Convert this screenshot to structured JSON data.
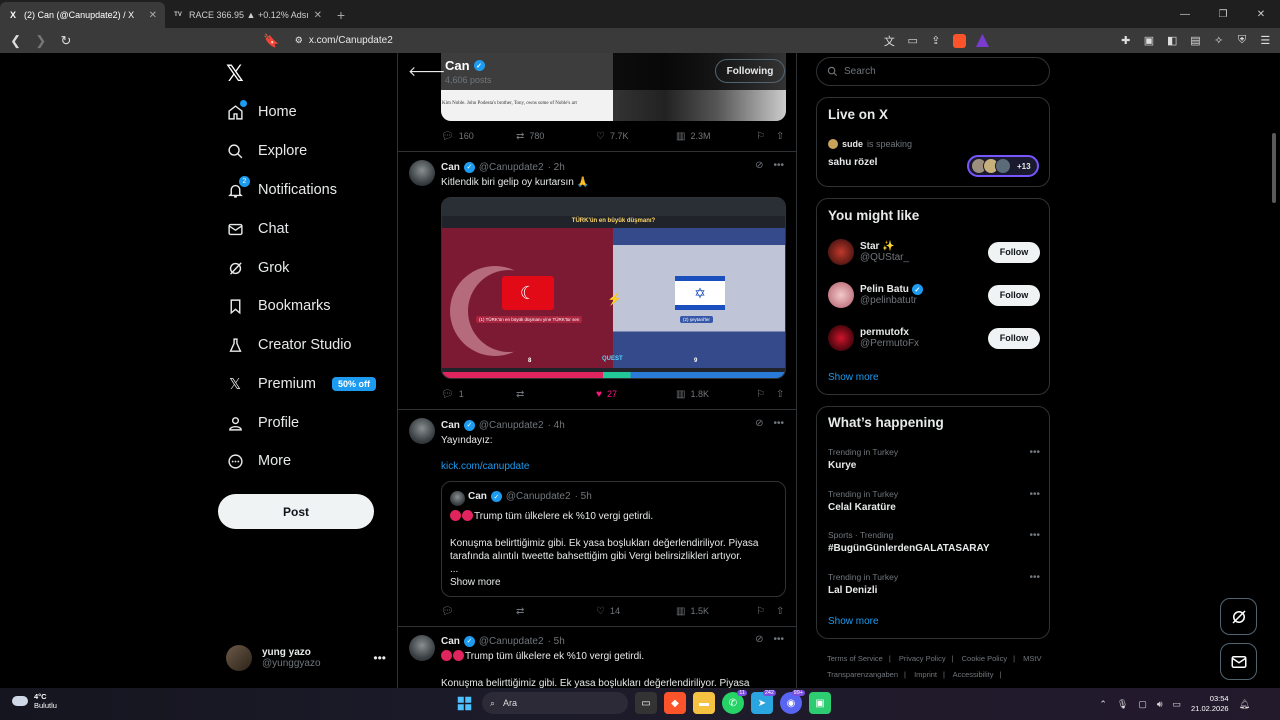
{
  "browser": {
    "tabs": [
      {
        "title": "(2) Can (@Canupdate2) / X",
        "favicon": "X",
        "active": true
      },
      {
        "title": "RACE 366.95 ▲ +0.12% Adsız",
        "favicon": "TV",
        "active": false
      }
    ],
    "url": "x.com/Canupdate2"
  },
  "leftnav": {
    "items": [
      {
        "label": "Home",
        "icon": "home-icon"
      },
      {
        "label": "Explore",
        "icon": "search-icon"
      },
      {
        "label": "Notifications",
        "icon": "bell-icon",
        "badge": "2"
      },
      {
        "label": "Chat",
        "icon": "mail-icon"
      },
      {
        "label": "Grok",
        "icon": "grok-icon"
      },
      {
        "label": "Bookmarks",
        "icon": "bookmark-icon"
      },
      {
        "label": "Creator Studio",
        "icon": "flask-icon"
      },
      {
        "label": "Premium",
        "icon": "x-icon",
        "badge": "50% off"
      },
      {
        "label": "Profile",
        "icon": "person-icon"
      },
      {
        "label": "More",
        "icon": "more-circle-icon"
      }
    ],
    "post_label": "Post",
    "account": {
      "name": "yung yazo",
      "handle": "@yunggyazo"
    }
  },
  "profile_header": {
    "name": "Can",
    "posts": "4,606 posts",
    "following_label": "Following"
  },
  "feed": {
    "prev_media_caption": "Kim Noble. John Podesta's brother, Tony, owns some of Noble's art",
    "prev_actions": {
      "replies": "160",
      "reposts": "780",
      "likes": "7.7K",
      "views": "2.3M"
    },
    "tweets": [
      {
        "name": "Can",
        "handle": "@Canupdate2",
        "time": "· 2h",
        "text": "Kitlendik biri gelip oy kurtarsın 🙏",
        "media": {
          "title": "TÜRK'ün en büyük düşmanı?",
          "left_caption": "(1) TÜRK'ün en büyük düşmanı yine TÜRK'tür sen",
          "right_caption": "(2) şeytanl'ler",
          "left_score": "8",
          "right_score": "9",
          "logo": "QUEST"
        },
        "actions": {
          "replies": "1",
          "reposts": "",
          "likes": "27",
          "views": "1.8K"
        }
      },
      {
        "name": "Can",
        "handle": "@Canupdate2",
        "time": "· 4h",
        "text": "Yayındayız:",
        "link": "kick.com/canupdate",
        "quote": {
          "name": "Can",
          "handle": "@Canupdate2",
          "time": "· 5h",
          "line1": "Trump tüm ülkelere ek %10 vergi getirdi.",
          "line2": "Konuşma belirttiğimiz gibi. Ek yasa boşlukları değerlendiriliyor. Piyasa tarafında alıntılı tweette bahsettiğim gibi Vergi belirsizlikleri artıyor.",
          "ellipsis": "...",
          "show_more": "Show more"
        },
        "actions": {
          "replies": "",
          "reposts": "",
          "likes": "14",
          "views": "1.5K"
        }
      },
      {
        "name": "Can",
        "handle": "@Canupdate2",
        "time": "· 5h",
        "line1": "Trump tüm ülkelere ek %10 vergi getirdi.",
        "line2": "Konuşma belirttiğimiz gibi. Ek yasa boşlukları değerlendiriliyor. Piyasa"
      }
    ]
  },
  "right": {
    "search_placeholder": "Search",
    "live": {
      "title": "Live on X",
      "speaker": "sude",
      "speaking": "is speaking",
      "room": "sahu rözel",
      "extra": "+13"
    },
    "might_like": {
      "title": "You might like",
      "users": [
        {
          "name": "Star ✨",
          "handle": "@QUStar_",
          "verified": false
        },
        {
          "name": "Pelin Batu",
          "handle": "@pelinbatutr",
          "verified": true
        },
        {
          "name": "permutofx",
          "handle": "@PermutoFx",
          "verified": false
        }
      ],
      "follow_label": "Follow",
      "show_more": "Show more"
    },
    "happening": {
      "title": "What’s happening",
      "trends": [
        {
          "context": "Trending in Turkey",
          "name": "Kurye"
        },
        {
          "context": "Trending in Turkey",
          "name": "Celal Karatüre"
        },
        {
          "context": "Sports · Trending",
          "name": "#BugünGünlerdenGALATASARAY"
        },
        {
          "context": "Trending in Turkey",
          "name": "Lal Denizli"
        }
      ],
      "show_more": "Show more"
    },
    "footer": [
      "Terms of Service",
      "|",
      "Privacy Policy",
      "|",
      "Cookie Policy",
      "|",
      "MStV Transparenzangaben",
      "|",
      "Imprint",
      "|",
      "Accessibility",
      "|"
    ]
  },
  "taskbar": {
    "weather_temp": "4°C",
    "weather_desc": "Bulutlu",
    "search": "Ara",
    "time": "03:54",
    "date": "21.02.2026",
    "whatsapp_badge": "11",
    "telegram_badge": "242",
    "discord_badge": "99+"
  }
}
